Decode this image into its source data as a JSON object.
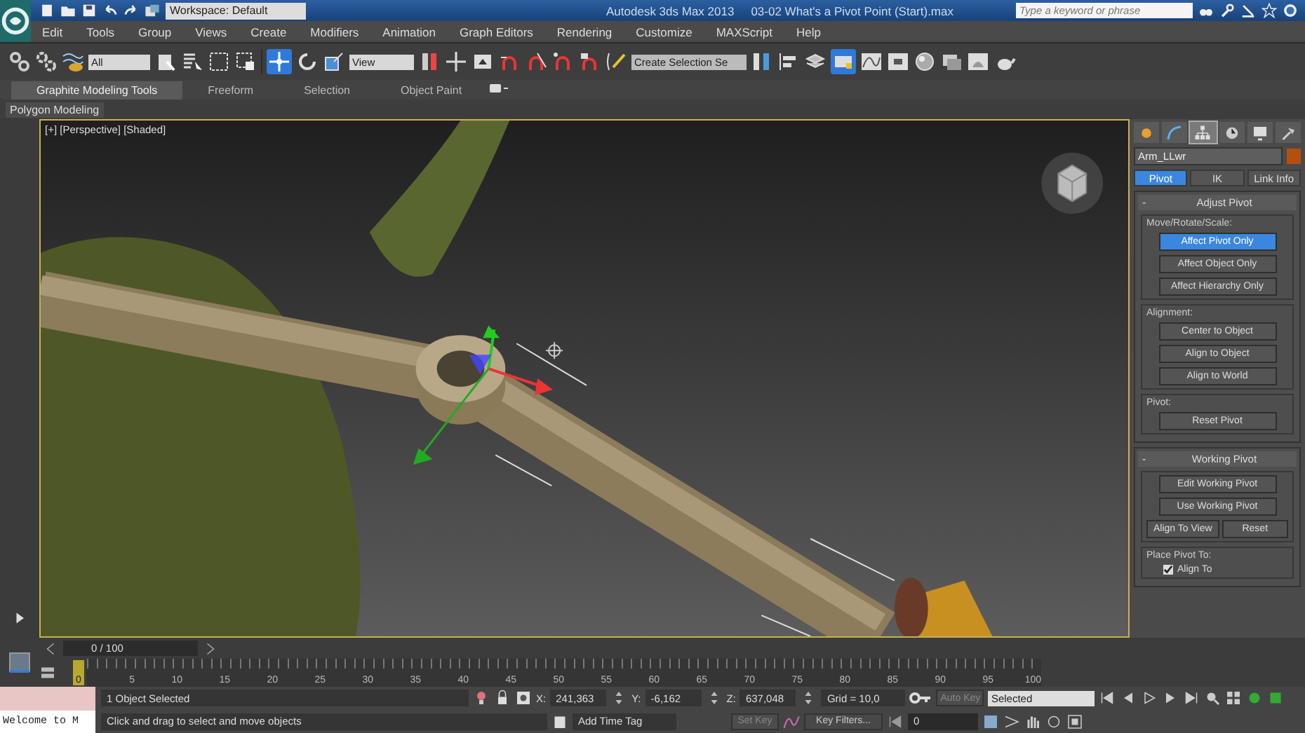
{
  "title_bar": {
    "workspace": "Workspace: Default",
    "app_title": "Autodesk 3ds Max 2013",
    "file_title": "03-02 What's a Pivot Point (Start).max",
    "search": {
      "placeholder": "Type a keyword or phrase"
    }
  },
  "menu": [
    "Edit",
    "Tools",
    "Group",
    "Views",
    "Create",
    "Modifiers",
    "Animation",
    "Graph Editors",
    "Rendering",
    "Customize",
    "MAXScript",
    "Help"
  ],
  "toolbar": {
    "selection_filter": "All",
    "reference_coord": "View",
    "named_selection": "Create Selection Se"
  },
  "ribbon": {
    "tabs": [
      {
        "label": "Graphite Modeling Tools",
        "selected": true
      },
      {
        "label": "Freeform",
        "selected": false
      },
      {
        "label": "Selection",
        "selected": false
      },
      {
        "label": "Object Paint",
        "selected": false
      }
    ],
    "panel_label": "Polygon Modeling"
  },
  "viewport": {
    "label": "[+] [Perspective] [Shaded]"
  },
  "command_panel": {
    "tabs": [
      {
        "kind": "create",
        "selected": false
      },
      {
        "kind": "modify",
        "selected": false
      },
      {
        "kind": "hierarchy",
        "selected": true
      },
      {
        "kind": "motion",
        "selected": false
      },
      {
        "kind": "display",
        "selected": false
      },
      {
        "kind": "utilities",
        "selected": false
      }
    ],
    "object_name": "Arm_LLwr",
    "color": "#b4500f",
    "subtabs": [
      {
        "label": "Pivot",
        "selected": true
      },
      {
        "label": "IK",
        "selected": false
      },
      {
        "label": "Link Info",
        "selected": false
      }
    ],
    "rollouts": [
      {
        "toggle": "-",
        "title": "Adjust Pivot",
        "groups": [
          {
            "title": "Move/Rotate/Scale:",
            "rows": [
              [
                {
                  "label": "Affect Pivot Only",
                  "selected": true
                }
              ],
              [
                {
                  "label": "Affect Object Only",
                  "selected": false
                }
              ],
              [
                {
                  "label": "Affect Hierarchy Only",
                  "selected": false
                }
              ]
            ]
          },
          {
            "title": "Alignment:",
            "rows": [
              [
                {
                  "label": "Center to Object",
                  "selected": false
                }
              ],
              [
                {
                  "label": "Align to Object",
                  "selected": false
                }
              ],
              [
                {
                  "label": "Align to World",
                  "selected": false
                }
              ]
            ]
          },
          {
            "title": "Pivot:",
            "rows": [
              [
                {
                  "label": "Reset Pivot",
                  "selected": false
                }
              ]
            ]
          }
        ]
      },
      {
        "toggle": "-",
        "title": "Working Pivot",
        "groups": [
          {
            "rows": [
              [
                {
                  "label": "Edit Working Pivot",
                  "selected": false
                }
              ],
              [
                {
                  "label": "Use Working Pivot",
                  "selected": false
                }
              ],
              [
                {
                  "label": "Align To View",
                  "selected": false
                },
                {
                  "label": "Reset",
                  "selected": false
                }
              ]
            ]
          },
          {
            "title": "Place Pivot To:",
            "checkbox": {
              "label": "Align To",
              "checked": true
            }
          }
        ]
      }
    ]
  },
  "timeline": {
    "frame_counter": "0 / 100",
    "level": 0,
    "start_label": "0",
    "ticks": [
      "5",
      "10",
      "15",
      "20",
      "25",
      "30",
      "35",
      "40",
      "45",
      "50",
      "55",
      "60",
      "65",
      "70",
      "75",
      "80",
      "85",
      "90",
      "95",
      "100"
    ]
  },
  "status": {
    "listener": "Welcome to M",
    "selection_info": "1 Object Selected",
    "prompt": "Click and drag to select and move objects",
    "coords": [
      {
        "axis": "X:",
        "value": "241,363"
      },
      {
        "axis": "Y:",
        "value": "-6,162"
      },
      {
        "axis": "Z:",
        "value": "637,048"
      }
    ],
    "grid": "Grid = 10,0",
    "time_tag": "Add Time Tag",
    "auto_key": "Auto Key",
    "key_mode": "Selected",
    "set_key": "Set Key",
    "key_filters": "Key Filters...",
    "frame": "0"
  }
}
